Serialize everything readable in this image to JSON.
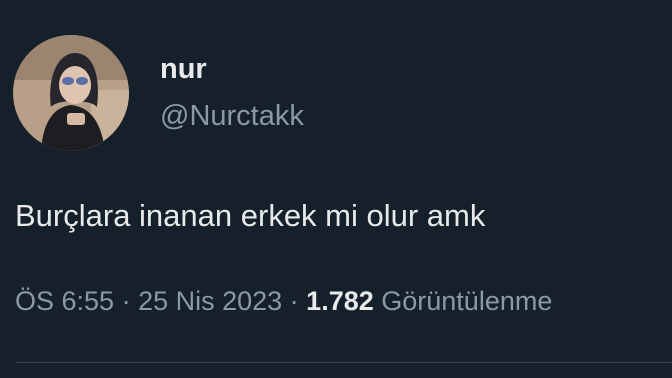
{
  "tweet": {
    "author": {
      "display_name": "nur",
      "handle": "@Nurctakk",
      "avatar_icon": "profile-photo"
    },
    "text": "Burçlara inanan erkek mi olur amk",
    "meta": {
      "time": "ÖS 6:55",
      "separator": " · ",
      "date": "25 Nis 2023",
      "views_count": "1.782",
      "views_label": "Görüntülenme"
    }
  },
  "colors": {
    "background": "#15202b",
    "primary_text": "#e7e9ea",
    "secondary_text": "#8b98a5",
    "divider": "#38444d"
  }
}
